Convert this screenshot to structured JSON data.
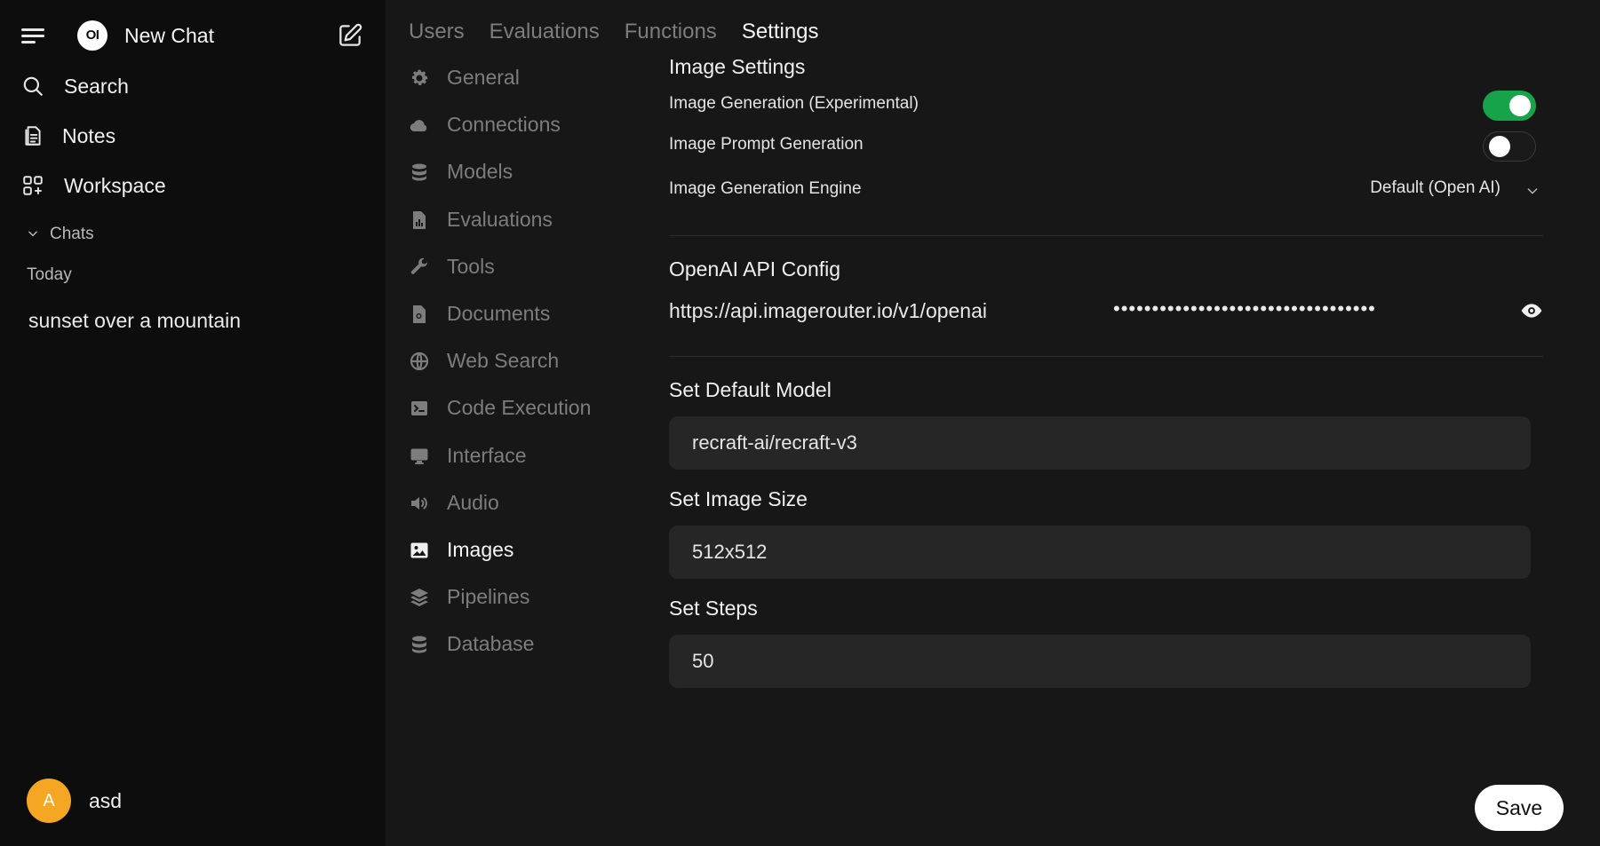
{
  "sidebar": {
    "new_chat_label": "New Chat",
    "logo_text": "OI",
    "items": [
      {
        "label": "Search",
        "icon": "search-icon"
      },
      {
        "label": "Notes",
        "icon": "notes-icon"
      },
      {
        "label": "Workspace",
        "icon": "workspace-icon"
      }
    ],
    "chats_label": "Chats",
    "today_label": "Today",
    "chats": [
      "sunset over a mountain"
    ],
    "user": {
      "initial": "A",
      "name": "asd",
      "avatar_color": "#f5a623"
    }
  },
  "tabs": [
    {
      "label": "Users",
      "active": false
    },
    {
      "label": "Evaluations",
      "active": false
    },
    {
      "label": "Functions",
      "active": false
    },
    {
      "label": "Settings",
      "active": true
    }
  ],
  "settings_nav": [
    {
      "label": "General",
      "icon": "gear-icon"
    },
    {
      "label": "Connections",
      "icon": "cloud-icon"
    },
    {
      "label": "Models",
      "icon": "database-icon"
    },
    {
      "label": "Evaluations",
      "icon": "document-chart-icon"
    },
    {
      "label": "Tools",
      "icon": "wrench-icon"
    },
    {
      "label": "Documents",
      "icon": "document-search-icon"
    },
    {
      "label": "Web Search",
      "icon": "globe-icon"
    },
    {
      "label": "Code Execution",
      "icon": "terminal-icon"
    },
    {
      "label": "Interface",
      "icon": "monitor-icon"
    },
    {
      "label": "Audio",
      "icon": "speaker-icon"
    },
    {
      "label": "Images",
      "icon": "image-icon",
      "active": true
    },
    {
      "label": "Pipelines",
      "icon": "layers-icon"
    },
    {
      "label": "Database",
      "icon": "database-icon"
    }
  ],
  "image_settings": {
    "title": "Image Settings",
    "generation_label": "Image Generation (Experimental)",
    "generation_enabled": true,
    "prompt_generation_label": "Image Prompt Generation",
    "prompt_generation_enabled": false,
    "engine_label": "Image Generation Engine",
    "engine_value": "Default (Open AI)"
  },
  "api_config": {
    "title": "OpenAI API Config",
    "url": "https://api.imagerouter.io/v1/openai",
    "key_masked": "••••••••••••••••••••••••••••••••••"
  },
  "default_model": {
    "label": "Set Default Model",
    "value": "recraft-ai/recraft-v3"
  },
  "image_size": {
    "label": "Set Image Size",
    "value": "512x512"
  },
  "steps": {
    "label": "Set Steps",
    "value": "50"
  },
  "save_label": "Save",
  "colors": {
    "accent_toggle": "#16a34a",
    "sidebar_bg": "#0d0d0d",
    "main_bg": "#171717"
  }
}
